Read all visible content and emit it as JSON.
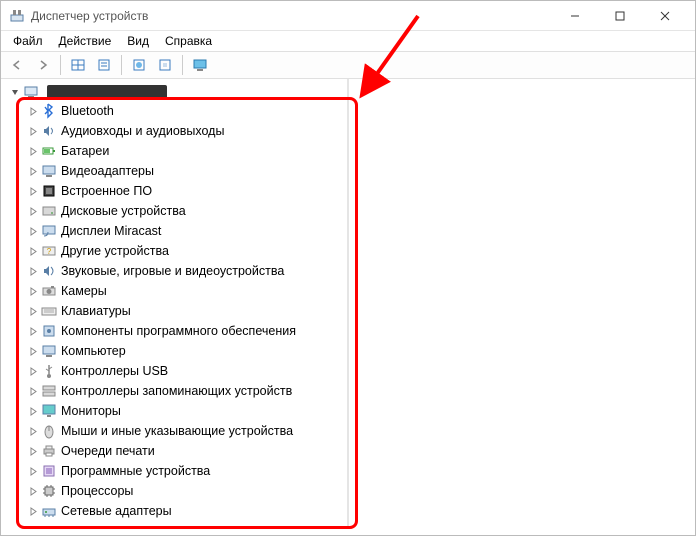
{
  "titlebar": {
    "title": "Диспетчер устройств"
  },
  "menu": {
    "file": "Файл",
    "action": "Действие",
    "view": "Вид",
    "help": "Справка"
  },
  "tree": {
    "items": [
      {
        "label": "Bluetooth",
        "icon": "bluetooth"
      },
      {
        "label": "Аудиовходы и аудиовыходы",
        "icon": "audio"
      },
      {
        "label": "Батареи",
        "icon": "battery"
      },
      {
        "label": "Видеоадаптеры",
        "icon": "display-adapter"
      },
      {
        "label": "Встроенное ПО",
        "icon": "firmware"
      },
      {
        "label": "Дисковые устройства",
        "icon": "disk"
      },
      {
        "label": "Дисплеи Miracast",
        "icon": "miracast"
      },
      {
        "label": "Другие устройства",
        "icon": "other"
      },
      {
        "label": "Звуковые, игровые и видеоустройства",
        "icon": "sound"
      },
      {
        "label": "Камеры",
        "icon": "camera"
      },
      {
        "label": "Клавиатуры",
        "icon": "keyboard"
      },
      {
        "label": "Компоненты программного обеспечения",
        "icon": "software"
      },
      {
        "label": "Компьютер",
        "icon": "computer"
      },
      {
        "label": "Контроллеры USB",
        "icon": "usb"
      },
      {
        "label": "Контроллеры запоминающих устройств",
        "icon": "storage-ctrl"
      },
      {
        "label": "Мониторы",
        "icon": "monitor"
      },
      {
        "label": "Мыши и иные указывающие устройства",
        "icon": "mouse"
      },
      {
        "label": "Очереди печати",
        "icon": "printer"
      },
      {
        "label": "Программные устройства",
        "icon": "software-dev"
      },
      {
        "label": "Процессоры",
        "icon": "cpu"
      },
      {
        "label": "Сетевые адаптеры",
        "icon": "network"
      }
    ]
  }
}
